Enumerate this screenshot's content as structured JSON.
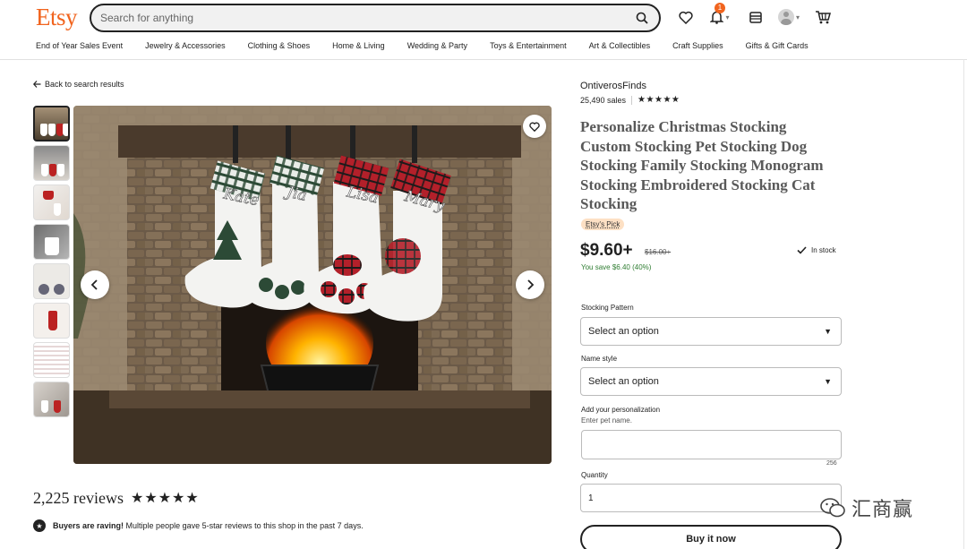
{
  "header": {
    "logo": "Etsy",
    "search_placeholder": "Search for anything",
    "notification_count": "1"
  },
  "categories": [
    "End of Year Sales Event",
    "Jewelry & Accessories",
    "Clothing & Shoes",
    "Home & Living",
    "Wedding & Party",
    "Toys & Entertainment",
    "Art & Collectibles",
    "Craft Supplies",
    "Gifts & Gift Cards"
  ],
  "listing": {
    "back_label": "Back to search results",
    "shop_name": "OntiverosFinds",
    "sales": "25,490 sales",
    "shop_stars": "★★★★★",
    "title": "Personalize Christmas Stocking Custom Stocking Pet Stocking Dog Stocking Family Stocking Monogram Stocking Embroidered Stocking Cat Stocking",
    "badge": "Etsy's Pick",
    "price": "$9.60+",
    "original_price": "$16.00+",
    "savings": "You save $6.40 (40%)",
    "stock_status": "In stock",
    "stocking_names": [
      "Kate",
      "Jia",
      "Lisa",
      "Mary"
    ]
  },
  "options": {
    "pattern_label": "Stocking Pattern",
    "pattern_value": "Select an option",
    "name_style_label": "Name style",
    "name_style_value": "Select an option",
    "personalization_label": "Add your personalization",
    "personalization_hint": "Enter pet name.",
    "char_count": "256",
    "quantity_label": "Quantity",
    "quantity_value": "1",
    "buy_label": "Buy it now"
  },
  "reviews": {
    "count": "2,225 reviews",
    "stars": "★★★★★",
    "raving_bold": "Buyers are raving!",
    "raving_text": " Multiple people gave 5-star reviews to this shop in the past 7 days."
  },
  "watermark": "汇商赢",
  "colors": {
    "brand": "#F1641E",
    "savings": "#2f7d32",
    "badge_bg": "#fde0c4"
  }
}
